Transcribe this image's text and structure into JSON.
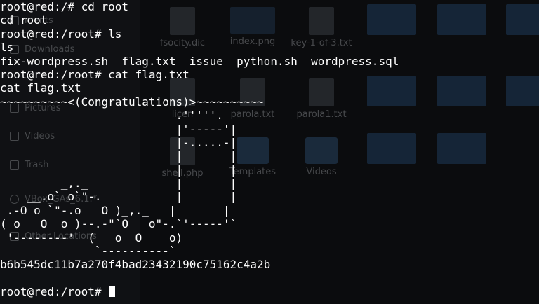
{
  "file_manager": {
    "sidebar": [
      {
        "label": "ments",
        "icon": "documents-icon"
      },
      {
        "label": "Downloads",
        "icon": "downloads-icon"
      },
      {
        "label": "Pictures",
        "icon": "pictures-icon"
      },
      {
        "label": "Videos",
        "icon": "videos-icon"
      },
      {
        "label": "Trash",
        "icon": "trash-icon"
      },
      {
        "label": "VBox_GAs_6.1.*",
        "icon": "disc-icon"
      },
      {
        "label": "Other Locations",
        "icon": "plus-icon"
      }
    ],
    "files": [
      {
        "label": "fsocity.dic",
        "kind": "text"
      },
      {
        "label": "index.png",
        "kind": "image"
      },
      {
        "label": "key-1-of-3.txt",
        "kind": "text"
      },
      {
        "label": "",
        "kind": "selected"
      },
      {
        "label": "",
        "kind": "selected"
      },
      {
        "label": "",
        "kind": "selected"
      },
      {
        "label": "licen",
        "kind": "text"
      },
      {
        "label": "parola.txt",
        "kind": "text"
      },
      {
        "label": "parola1.txt",
        "kind": "text"
      },
      {
        "label": "",
        "kind": "selected"
      },
      {
        "label": "",
        "kind": "selected"
      },
      {
        "label": "",
        "kind": "selected"
      },
      {
        "label": "shell.php",
        "kind": "text"
      },
      {
        "label": "Templates",
        "kind": "folder"
      },
      {
        "label": "Videos",
        "kind": "folder"
      },
      {
        "label": "",
        "kind": "selected"
      },
      {
        "label": "",
        "kind": "selected"
      }
    ]
  },
  "terminal": {
    "lines": [
      "root@red:/# cd root",
      "cd root",
      "root@red:/root# ls",
      "ls",
      "fix-wordpress.sh  flag.txt  issue  python.sh  wordpress.sql",
      "root@red:/root# cat flag.txt",
      "cat flag.txt",
      "~~~~~~~~~~<(Congratulations)>~~~~~~~~~~",
      "                          .'''''.",
      "                          |'-----'|",
      "                          |-.....-|",
      "                          |       |",
      "                          |       |",
      "         _,._             |       |",
      "    __.o` o`\"-.           |       |",
      " .-O o `\"-.o   O )_,._   |       |",
      "( o   O  o )--.-\"`O   o\"-.`'-----'`",
      " '--------'  (   o  O    o)",
      "              `----------`",
      "b6b545dc11b7a270f4bad23432190c75162c4a2b",
      ""
    ],
    "prompt": "root@red:/root# "
  }
}
